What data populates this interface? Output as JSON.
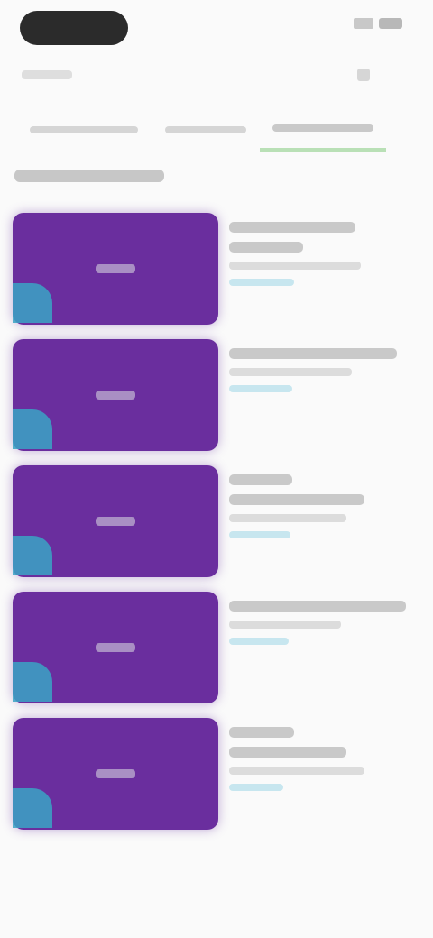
{
  "status_bar": {
    "icons": [
      "signal-icon",
      "battery-icon"
    ]
  },
  "nav": {
    "back_icon": "back-arrow-icon",
    "action_icon": "more-icon"
  },
  "tabs": [
    {
      "label": ""
    },
    {
      "label": ""
    },
    {
      "label": "",
      "active": true
    }
  ],
  "section": {
    "title": ""
  },
  "list": {
    "items": [
      {
        "thumb_label": "",
        "title": "",
        "subtitle": "",
        "meta": ""
      },
      {
        "thumb_label": "",
        "title": "",
        "subtitle": "",
        "meta": ""
      },
      {
        "thumb_label": "",
        "title": "",
        "subtitle": "",
        "meta": ""
      },
      {
        "thumb_label": "",
        "title": "",
        "subtitle": "",
        "meta": ""
      },
      {
        "thumb_label": "",
        "title": "",
        "subtitle": "",
        "meta": ""
      }
    ]
  },
  "colors": {
    "thumb_bg": "#6a2e9e",
    "badge": "#3aa3c4",
    "active_tab_underline": "#b9e0b6",
    "background": "#fafafa"
  }
}
